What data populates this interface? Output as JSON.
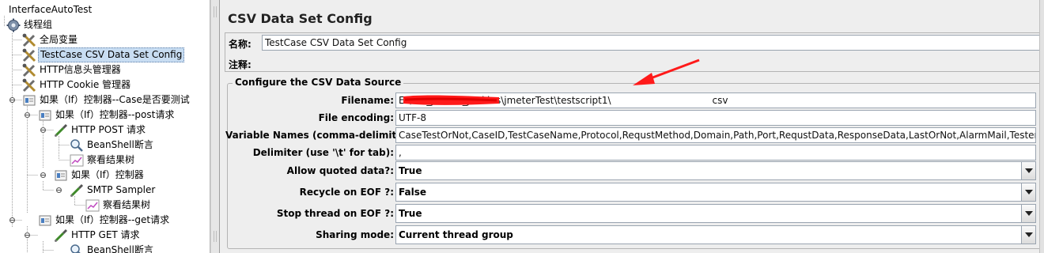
{
  "tree": {
    "nodes": [
      {
        "label": "InterfaceAutoTest",
        "icon": "test-plan-icon"
      },
      {
        "label": "线程组",
        "icon": "gear-icon"
      },
      {
        "label": "全局变量",
        "icon": "config-tools-icon"
      },
      {
        "label": "TestCase CSV Data Set Config",
        "icon": "config-tools-icon",
        "selected": true
      },
      {
        "label": "HTTP信息头管理器",
        "icon": "config-tools-icon"
      },
      {
        "label": "HTTP Cookie 管理器",
        "icon": "config-tools-icon"
      },
      {
        "label": "如果（If）控制器--Case是否要测试",
        "icon": "controller-icon"
      },
      {
        "label": "如果（If）控制器--post请求",
        "icon": "controller-icon"
      },
      {
        "label": "HTTP POST 请求",
        "icon": "sampler-pipette-icon"
      },
      {
        "label": "BeanShell断言",
        "icon": "magnifier-icon"
      },
      {
        "label": "察看结果树",
        "icon": "listener-chart-icon"
      },
      {
        "label": "如果（If）控制器",
        "icon": "controller-icon"
      },
      {
        "label": "SMTP Sampler",
        "icon": "sampler-pipette-icon"
      },
      {
        "label": "察看结果树",
        "icon": "listener-chart-icon"
      },
      {
        "label": "如果（If）控制器--get请求",
        "icon": "controller-icon"
      },
      {
        "label": "HTTP GET 请求",
        "icon": "sampler-pipette-icon"
      },
      {
        "label": "BeanShell断言",
        "icon": "magnifier-icon"
      }
    ]
  },
  "config": {
    "title": "CSV Data Set Config",
    "name_label": "名称:",
    "name_value": "TestCase CSV Data Set Config",
    "comment_label": "注释:",
    "comment_value": "",
    "group_title": "Configure the CSV Data Source",
    "fields": [
      {
        "label": "Filename:",
        "value_prefix": "E:\\ant_jmeter_jenkins\\jmeterTest\\testscript1\\",
        "value_suffix": "csv"
      },
      {
        "label": "File encoding:",
        "value": "UTF-8"
      },
      {
        "label": "Variable Names (comma-delimited):",
        "value": "CaseTestOrNot,CaseID,TestCaseName,Protocol,RequstMethod,Domain,Path,Port,RequstData,ResponseData,LastOrNot,AlarmMail,Tester"
      },
      {
        "label": "Delimiter (use '\\t' for tab):",
        "value": ","
      }
    ],
    "selects": [
      {
        "label": "Allow quoted data?:",
        "value": "True"
      },
      {
        "label": "Recycle on EOF ?:",
        "value": "False"
      },
      {
        "label": "Stop thread on EOF ?:",
        "value": "True"
      },
      {
        "label": "Sharing mode:",
        "value": "Current thread group"
      }
    ]
  },
  "colors": {
    "annotation_red": "#ff1a1a",
    "selection": "#c8ddf2",
    "panel_bg": "#eeeeee"
  }
}
